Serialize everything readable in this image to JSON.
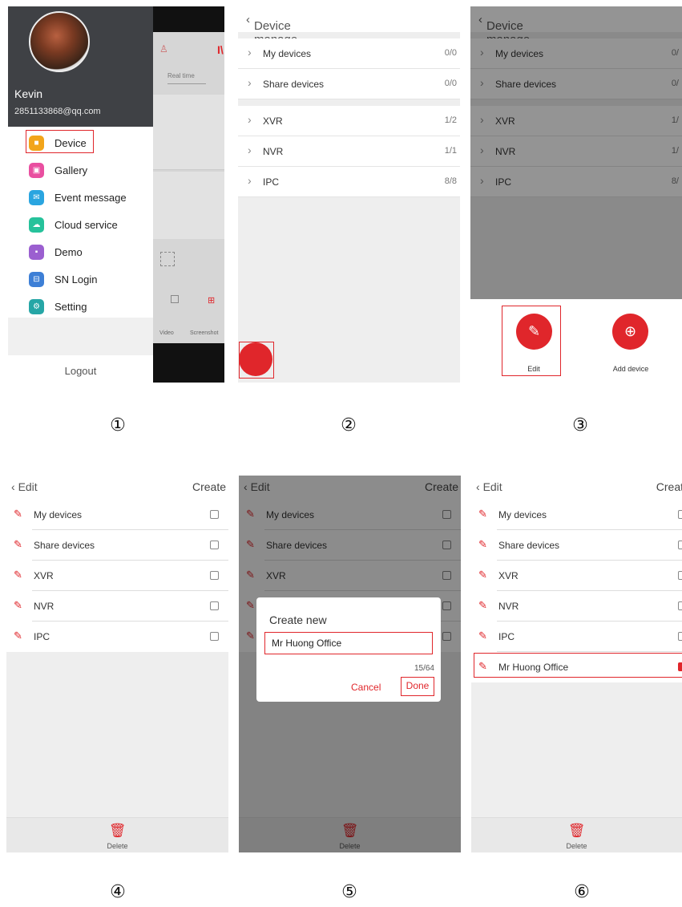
{
  "steps": [
    "①",
    "②",
    "③",
    "④",
    "⑤",
    "⑥"
  ],
  "panel1": {
    "user_name": "Kevin",
    "user_email": "2851133868@qq.com",
    "menu": [
      {
        "label": "Device",
        "icon": "video-camera-icon",
        "color": "#f2a51a"
      },
      {
        "label": "Gallery",
        "icon": "image-icon",
        "color": "#e94fa0"
      },
      {
        "label": "Event message",
        "icon": "envelope-icon",
        "color": "#2aa5e0"
      },
      {
        "label": "Cloud service",
        "icon": "cloud-icon",
        "color": "#26c29b"
      },
      {
        "label": "Demo",
        "icon": "demo-icon",
        "color": "#9b5fd0"
      },
      {
        "label": "SN Login",
        "icon": "scan-icon",
        "color": "#3d7fd6"
      },
      {
        "label": "Setting",
        "icon": "gear-icon",
        "color": "#26a6a6"
      }
    ],
    "logout": "Logout",
    "bg_tab": "Real time",
    "bg_video": "Video",
    "bg_screenshot": "Screenshot"
  },
  "device_manage": {
    "title": "Device manage",
    "rows": [
      {
        "label": "My devices",
        "count": "0/0"
      },
      {
        "label": "Share devices",
        "count": "0/0"
      },
      {
        "label": "XVR",
        "count": "1/2"
      },
      {
        "label": "NVR",
        "count": "1/1"
      },
      {
        "label": "IPC",
        "count": "8/8"
      }
    ],
    "counts_truncated": [
      "0/",
      "0/",
      "1/",
      "1/",
      "8/"
    ],
    "edit_label": "Edit",
    "add_device_label": "Add device"
  },
  "edit": {
    "title": "Edit",
    "create": "Create",
    "create_truncated": "Creat",
    "rows": [
      "My devices",
      "Share devices",
      "XVR",
      "NVR",
      "IPC"
    ],
    "new_row": "Mr Huong Office",
    "delete": "Delete"
  },
  "dialog": {
    "title": "Create new",
    "input_value": "Mr Huong Office",
    "counter": "15/64",
    "cancel": "Cancel",
    "done": "Done"
  },
  "colors": {
    "accent": "#e0262b",
    "header_dark": "#3f4145"
  }
}
